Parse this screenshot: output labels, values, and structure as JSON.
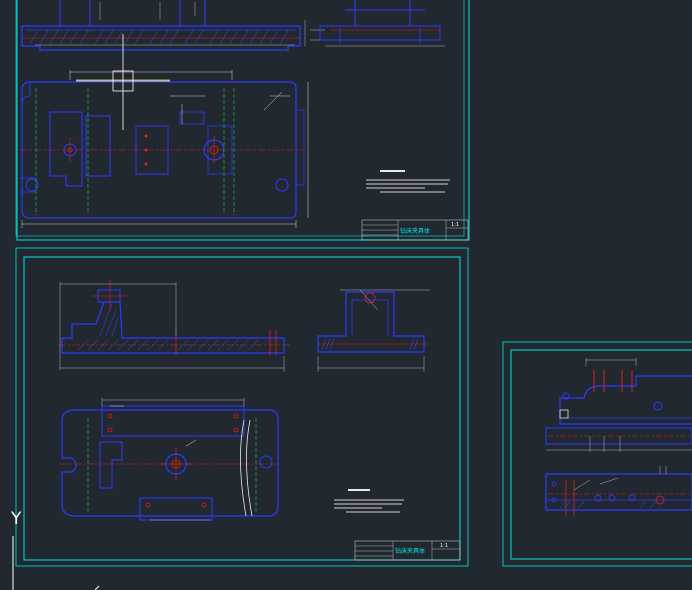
{
  "app": {
    "type": "CAD model space viewer",
    "background_color": "#212830"
  },
  "sheets": [
    {
      "id": "sheet-1",
      "title_block": {
        "title": "钻床夹具体",
        "scale": "1:1"
      }
    },
    {
      "id": "sheet-2",
      "title_block": {
        "title": "钻床夹具体",
        "scale": "1:1"
      }
    },
    {
      "id": "sheet-3",
      "title_block": {
        "title": ""
      }
    }
  ],
  "ucs": {
    "y_axis_label": "Y"
  },
  "colors": {
    "frame": "#00e5e5",
    "part_outline": "#2a3cff",
    "center_line": "#e02020",
    "hidden_line": "#14a83c",
    "dimension": "#d8d8d8",
    "text": "#ffffff",
    "highlight": "#f0e030"
  }
}
